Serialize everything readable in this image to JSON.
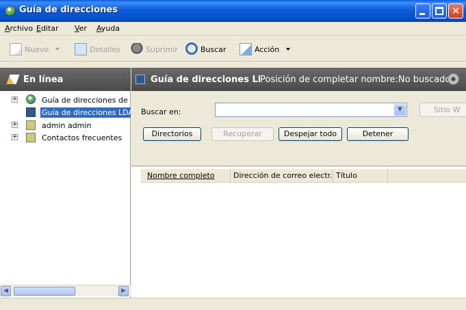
{
  "window": {
    "title": "Guía de direcciones"
  },
  "menu": {
    "items": [
      {
        "label": "Archivo",
        "accel": "A",
        "rest": "rchivo"
      },
      {
        "label": "Editar",
        "accel": "E",
        "rest": "ditar"
      },
      {
        "label": "Ver",
        "accel": "V",
        "rest": "er"
      },
      {
        "label": "Ayuda",
        "accel": "A",
        "rest": "yuda"
      }
    ]
  },
  "toolbar": {
    "new_label": "Nuevo",
    "details_label": "Detalles",
    "delete_label": "Suprimir",
    "search_label": "Buscar",
    "action_label": "Acción"
  },
  "left_pane": {
    "header": "En línea",
    "tree": [
      {
        "label": "Guía de direcciones de Gi",
        "icon": "globe-icon",
        "expander": "+"
      },
      {
        "label": "Guía de direcciones LDAF",
        "icon": "ldap-directory-icon",
        "expander": "",
        "selected": true
      },
      {
        "label": "admin admin",
        "icon": "address-book-icon",
        "expander": "+"
      },
      {
        "label": "Contactos frecuentes",
        "icon": "address-book-icon",
        "expander": "+"
      }
    ]
  },
  "right_pane": {
    "header_title": "Guía de direcciones LDA",
    "header_status": "Posición de completar nombre:No buscado",
    "search_label": "Buscar en:",
    "search_value": "",
    "site_button": "Sitio W",
    "buttons": {
      "directories": "Directorios",
      "recover": "Recuperar",
      "clear_all": "Despejar todo",
      "stop": "Detener"
    },
    "columns": [
      "Nombre completo",
      "Dirección de correo electr...",
      "Título"
    ]
  },
  "colors": {
    "titlebar": "#0A5FE0",
    "selection": "#316AC5",
    "pane_header": "#5a5a5a"
  }
}
